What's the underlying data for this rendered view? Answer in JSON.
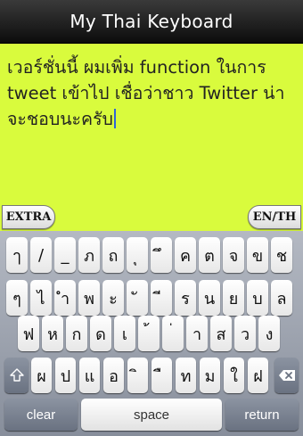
{
  "header": {
    "title": "My Thai Keyboard"
  },
  "editor": {
    "text": "เวอร์ชั่นนี้ ผมเพิ่ม function ในการ tweet เข้าไป เชื่อว่าชาว Twitter น่าจะชอบนะครับ",
    "background": "#d9fb3d"
  },
  "toolbar": {
    "extra_label": "EXTRA",
    "lang_label": "EN/TH"
  },
  "keyboard": {
    "row1": [
      "ๅ",
      "/",
      "_",
      "ภ",
      "ถ",
      "ุ",
      "ึ",
      "ค",
      "ต",
      "จ",
      "ข",
      "ช"
    ],
    "row2": [
      "ๆ",
      "ไ",
      "ำ",
      "พ",
      "ะ",
      "ั",
      "ี",
      "ร",
      "น",
      "ย",
      "บ",
      "ล"
    ],
    "row3": [
      "ฟ",
      "ห",
      "ก",
      "ด",
      "เ",
      "้",
      "่",
      "า",
      "ส",
      "ว",
      "ง"
    ],
    "row4": [
      "ผ",
      "ป",
      "แ",
      "อ",
      "ิ",
      "ื",
      "ท",
      "ม",
      "ใ",
      "ฝ"
    ],
    "shift_icon": "shift-arrow-icon",
    "delete_icon": "backspace-icon",
    "clear_label": "clear",
    "space_label": "space",
    "return_label": "return"
  }
}
